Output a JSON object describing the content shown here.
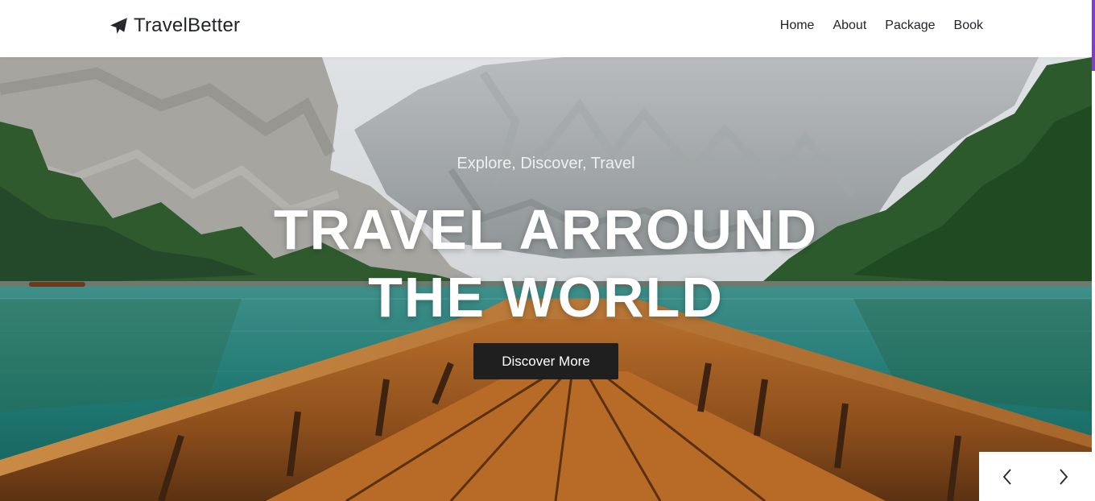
{
  "nav": {
    "brand": "TravelBetter",
    "brand_icon": "paper-plane-icon",
    "links": [
      "Home",
      "About",
      "Package",
      "Book"
    ]
  },
  "hero": {
    "subtitle": "Explore, Discover, Travel",
    "title_line1": "TRAVEL ARROUND",
    "title_line2": "THE WORLD",
    "cta_label": "Discover More"
  },
  "carousel": {
    "prev_icon": "chevron-left-icon",
    "next_icon": "chevron-right-icon"
  },
  "colors": {
    "accent": "#7f3fbf",
    "button_bg": "#1f1f1f",
    "text_dark": "#212529"
  }
}
